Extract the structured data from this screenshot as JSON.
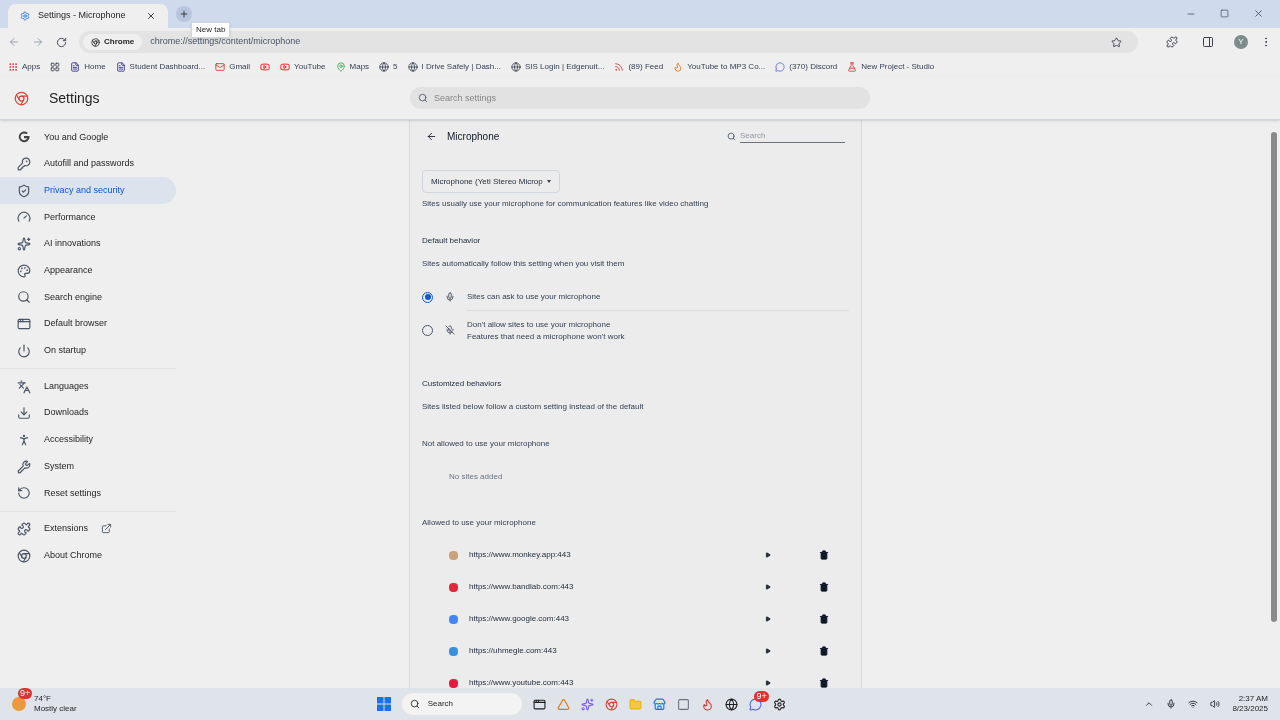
{
  "tab": {
    "title": "Settings - Microphone",
    "tooltip": "New tab"
  },
  "omnibox": {
    "chip": "Chrome",
    "url": "chrome://settings/content/microphone",
    "avatar": "Y"
  },
  "bookmarks": [
    {
      "kind": "apps",
      "label": "Apps"
    },
    {
      "kind": "grid"
    },
    {
      "kind": "doc",
      "label": "Home"
    },
    {
      "kind": "doc",
      "label": "Student Dashboard..."
    },
    {
      "kind": "mail",
      "label": "Gmail"
    },
    {
      "kind": "video"
    },
    {
      "kind": "video",
      "label": "YouTube"
    },
    {
      "kind": "pin",
      "label": "Maps"
    },
    {
      "kind": "globe",
      "label": "5"
    },
    {
      "kind": "globe",
      "label": "I Drive Safely | Dash..."
    },
    {
      "kind": "globe",
      "label": "SIS Login | Edgenuit..."
    },
    {
      "kind": "feed",
      "label": "(89) Feed"
    },
    {
      "kind": "fox",
      "label": "YouTube to MP3 Co..."
    },
    {
      "kind": "chat",
      "label": "(370) Discord"
    },
    {
      "kind": "flask",
      "label": "New Project - Studio"
    }
  ],
  "settings": {
    "title": "Settings",
    "search_placeholder": "Search settings"
  },
  "sidebar": {
    "groups": [
      [
        {
          "kind": "google",
          "label": "You and Google",
          "selected": false
        },
        {
          "kind": "key",
          "label": "Autofill and passwords",
          "selected": false
        },
        {
          "kind": "shield",
          "label": "Privacy and security",
          "selected": true
        },
        {
          "kind": "gauge",
          "label": "Performance",
          "selected": false
        },
        {
          "kind": "sparkle",
          "label": "AI innovations",
          "selected": false
        },
        {
          "kind": "palette",
          "label": "Appearance",
          "selected": false
        },
        {
          "kind": "search",
          "label": "Search engine",
          "selected": false
        },
        {
          "kind": "browser",
          "label": "Default browser",
          "selected": false
        },
        {
          "kind": "power",
          "label": "On startup",
          "selected": false
        }
      ],
      [
        {
          "kind": "languages",
          "label": "Languages",
          "selected": false
        },
        {
          "kind": "download",
          "label": "Downloads",
          "selected": false
        },
        {
          "kind": "accessibility",
          "label": "Accessibility",
          "selected": false
        },
        {
          "kind": "wrench",
          "label": "System",
          "selected": false
        },
        {
          "kind": "reset",
          "label": "Reset settings",
          "selected": false
        }
      ],
      [
        {
          "kind": "puzzle",
          "label": "Extensions",
          "selected": false,
          "external": true
        },
        {
          "kind": "chrome",
          "label": "About Chrome",
          "selected": false
        }
      ]
    ]
  },
  "page": {
    "title": "Microphone",
    "search_placeholder": "Search",
    "device": "Microphone (Yeti Stereo Microp",
    "description": "Sites usually use your microphone for communication features like video chatting",
    "default_heading": "Default behavior",
    "default_sub": "Sites automatically follow this setting when you visit them",
    "options": [
      {
        "kind": "mic",
        "label": "Sites can ask to use your microphone",
        "selected": true
      },
      {
        "kind": "mic-off",
        "label": "Don't allow sites to use your microphone",
        "sublabel": "Features that need a microphone won't work",
        "selected": false
      }
    ],
    "custom_heading": "Customized behaviors",
    "custom_sub": "Sites listed below follow a custom setting instead of the default",
    "blocked_heading": "Not allowed to use your microphone",
    "blocked_empty": "No sites added",
    "allowed_heading": "Allowed to use your microphone",
    "allowed": [
      {
        "url": "https://www.monkey.app:443",
        "color": "#c8a27a"
      },
      {
        "url": "https://www.bandlab.com:443",
        "color": "#e0283a"
      },
      {
        "url": "https://www.google.com:443",
        "color": "#4285f4"
      },
      {
        "url": "https://uhmegle.com:443",
        "color": "#3b8fe0"
      },
      {
        "url": "https://www.youtube.com:443",
        "color": "#e8193c"
      }
    ]
  },
  "taskbar": {
    "temp": "74°F",
    "weather": "Mostly clear",
    "weather_badge": "9+",
    "search": "Search",
    "chat_badge": "9+",
    "time": "2:37 AM",
    "date": "8/23/2025"
  }
}
